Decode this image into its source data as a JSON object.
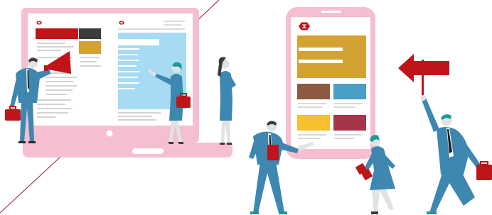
{
  "scene": {
    "kind": "marketing-illustration",
    "colors": {
      "brand_red": "#c0141b",
      "device_pink": "#f6bfd0",
      "ochre": "#d4a233",
      "steel_blue": "#3d87b0",
      "brown": "#8b5a41",
      "yellow": "#f6bf2e",
      "wine": "#a8344a",
      "light_blue": "#a7dbf4",
      "teal_hair": "#1a9b94",
      "line_grey": "#cfcfcf",
      "dark_grey": "#3b3b3b",
      "skin": "#dfe3e6"
    },
    "icons": {
      "brand_mark": "hexagon-logo-icon",
      "megaphone": "megaphone-icon",
      "arrow": "left-arrow-sign-icon",
      "briefcase": "briefcase-icon"
    },
    "laptop": {
      "screens": 2
    },
    "phone": {
      "tiles": [
        "ochre",
        "steel_blue",
        "brown",
        "yellow",
        "wine"
      ]
    },
    "people": [
      "man-with-megaphone",
      "woman-pointing-at-screen",
      "woman-thinking",
      "man-presenting-phone",
      "woman-with-boxes",
      "man-holding-arrow-sign"
    ]
  }
}
